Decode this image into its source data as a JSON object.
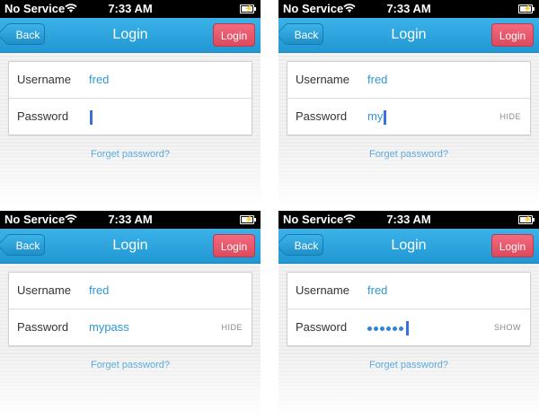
{
  "status": {
    "carrier": "No Service",
    "time": "7:33 AM"
  },
  "nav": {
    "back": "Back",
    "title": "Login",
    "login": "Login"
  },
  "form": {
    "username_label": "Username",
    "password_label": "Password",
    "forgot": "Forget password?"
  },
  "screens": [
    {
      "username": "fred",
      "password": "",
      "toggle": ""
    },
    {
      "username": "fred",
      "password": "my",
      "toggle": "HIDE"
    },
    {
      "username": "fred",
      "password": "mypass",
      "toggle": "HIDE"
    },
    {
      "username": "fred",
      "password": "",
      "toggle": "SHOW"
    }
  ],
  "colors": {
    "nav_blue": "#2ba6e0",
    "login_red": "#e85a6e",
    "link_blue": "#2f97d5",
    "cursor": "#3a6fe0"
  },
  "icons": [
    "wifi-icon",
    "battery-icon"
  ]
}
